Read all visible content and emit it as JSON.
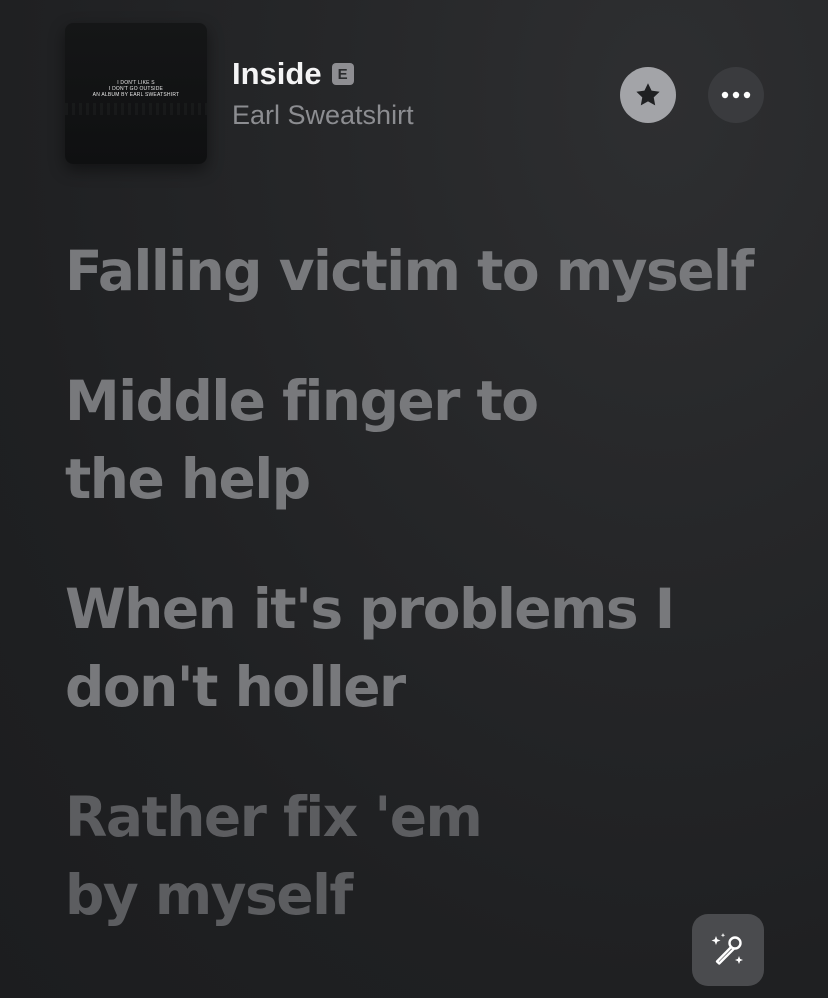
{
  "album": {
    "art_lines": [
      "I DON'T LIKE S",
      "I DON'T GO OUTSIDE",
      "AN ALBUM BY EARL SWEATSHIRT"
    ]
  },
  "track": {
    "title": "Inside",
    "explicit_label": "E",
    "artist": "Earl Sweatshirt"
  },
  "actions": {
    "favorite_icon": "star-icon",
    "more_icon": "ellipsis-icon",
    "sing_icon": "microphone-sparkle-icon"
  },
  "lyrics": [
    {
      "lines": [
        "Falling victim to myself"
      ]
    },
    {
      "lines": [
        "Middle finger to",
        "the help"
      ]
    },
    {
      "lines": [
        "When it's problems I",
        "don't holler"
      ]
    },
    {
      "lines": [
        "Rather fix 'em",
        "by myself"
      ]
    }
  ],
  "colors": {
    "background": "#232426",
    "lyric_text": "#78797c",
    "star_button_bg": "#a3a4a8",
    "more_button_bg": "#3a3b3e"
  }
}
